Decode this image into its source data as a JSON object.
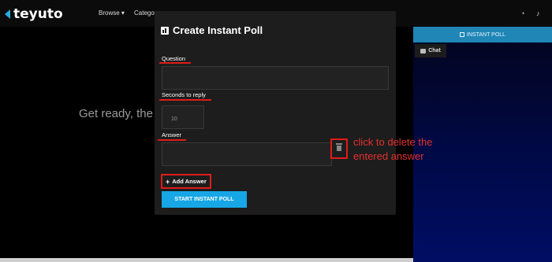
{
  "nav": {
    "logo": "teyuto",
    "browse": "Browse ▾",
    "categories": "Categor"
  },
  "stream": {
    "get_ready_text": "Get ready, the"
  },
  "right_panel": {
    "poll_header": "INSTANT POLL",
    "chat_tab": "Chat"
  },
  "modal": {
    "title": "Create Instant Poll",
    "question_label": "Question",
    "question_value": "",
    "seconds_label": "Seconds to reply",
    "seconds_value": "10",
    "answer_label": "Answer",
    "answer_value": "",
    "add_answer_label": "Add Answer",
    "start_button_label": "START INSTANT POLL"
  },
  "annotation": {
    "line1": "click to delete the",
    "line2": "entered answer"
  },
  "colors": {
    "accent": "#17a7e6",
    "highlight": "#e01b1b",
    "annotation_text": "#e53030",
    "poll_header": "#1f86b6"
  }
}
